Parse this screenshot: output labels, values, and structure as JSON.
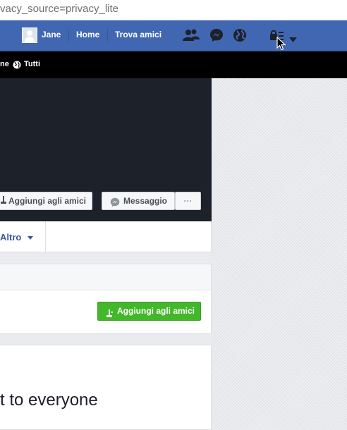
{
  "browser": {
    "url_visible": "vacy_source=privacy_lite"
  },
  "topbar": {
    "profile_name": "Jane",
    "home": "Home",
    "find_friends": "Trova amici",
    "icons": [
      "friend-requests-icon",
      "messenger-icon",
      "notifications-globe-icon",
      "privacy-lock-icon",
      "account-menu-caret-icon"
    ],
    "color": "#4267b2"
  },
  "privacy_bar": {
    "partial_label": "ne",
    "audience": "Tutti"
  },
  "cover": {
    "add_friend": "Aggiungi agli amici",
    "message": "Messaggio",
    "more": "···"
  },
  "tabs": {
    "more": "Altro"
  },
  "friend_card": {
    "add_friend": "Aggiungi agli amici",
    "button_color": "#42b72a"
  },
  "post": {
    "text": "t to everyone"
  }
}
